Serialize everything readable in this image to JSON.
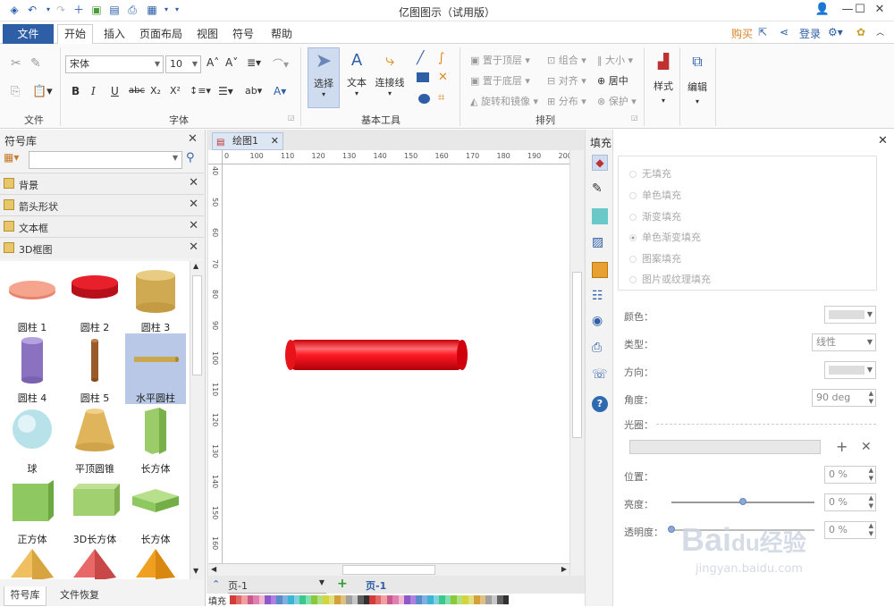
{
  "app": {
    "title": "亿图图示（试用版）"
  },
  "menu": {
    "file": "文件",
    "tabs": [
      "开始",
      "插入",
      "页面布局",
      "视图",
      "符号",
      "帮助"
    ],
    "right": [
      "购买",
      "登录"
    ]
  },
  "ribbon": {
    "font_name": "宋体",
    "font_size": "10",
    "groups": {
      "file": "文件",
      "font": "字体",
      "basic_tools": "基本工具",
      "arrange": "排列"
    },
    "tools": {
      "select": "选择",
      "text": "文本",
      "connector": "连接线",
      "style": "样式",
      "edit": "编辑"
    },
    "arrange": {
      "bring_front": "置于顶层",
      "send_back": "置于底层",
      "rotate_mirror": "旋转和镜像",
      "group": "组合",
      "align": "对齐",
      "distribute": "分布",
      "size": "大小",
      "center": "居中",
      "protect": "保护"
    }
  },
  "library": {
    "title": "符号库",
    "categories": [
      "背景",
      "箭头形状",
      "文本框",
      "3D框图"
    ],
    "shapes": [
      {
        "label": "圆柱 1"
      },
      {
        "label": "圆柱 2"
      },
      {
        "label": "圆柱 3"
      },
      {
        "label": "圆柱 4"
      },
      {
        "label": "圆柱 5"
      },
      {
        "label": "水平圆柱"
      },
      {
        "label": "球"
      },
      {
        "label": "平顶圆锥"
      },
      {
        "label": "长方体"
      },
      {
        "label": "正方体"
      },
      {
        "label": "3D长方体"
      },
      {
        "label": "长方体"
      }
    ],
    "bottom_tabs": [
      "符号库",
      "文件恢复"
    ]
  },
  "canvas": {
    "doc_tab": "绘图1",
    "ruler_h": [
      "0",
      "100",
      "110",
      "120",
      "130",
      "140",
      "150",
      "160",
      "170",
      "180",
      "190",
      "200"
    ],
    "ruler_v": [
      "40",
      "50",
      "60",
      "70",
      "80",
      "90",
      "100",
      "110",
      "120",
      "130",
      "140",
      "150",
      "160"
    ],
    "page_select": "页-1",
    "page_tab": "页-1",
    "fill_label": "填充"
  },
  "fill_panel": {
    "title": "填充",
    "options": [
      "无填充",
      "单色填充",
      "渐变填充",
      "单色渐变填充",
      "图案填充",
      "图片或纹理填充"
    ],
    "selected_option": "单色渐变填充",
    "props": {
      "color_label": "颜色：",
      "type_label": "类型：",
      "type_value": "线性",
      "direction_label": "方向：",
      "angle_label": "角度：",
      "angle_value": "90 deg",
      "aperture_label": "光圈：",
      "position_label": "位置：",
      "position_value": "0 %",
      "brightness_label": "亮度：",
      "brightness_value": "0 %",
      "opacity_label": "透明度：",
      "opacity_value": "0 %"
    },
    "brightness_level": 0.5,
    "opacity_level": 0.0
  },
  "watermark": {
    "line1": "Bai",
    "line2": "du经验",
    "url": "jingyan.baidu.com"
  },
  "colors": {
    "accent": "#2e5ea6",
    "cylinder_red": "#e8121a",
    "selection": "#b9c8e6"
  }
}
